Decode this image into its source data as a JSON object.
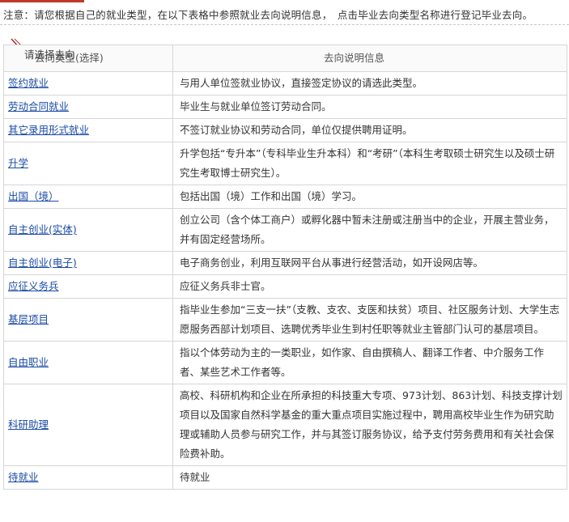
{
  "notice": "注意：请您根据自己的就业类型，在以下表格中参照就业去向说明信息，　点击毕业去向类型名称进行登记毕业去向。",
  "overlap_label": "请选择去向",
  "table": {
    "headers": {
      "type": "去向类型(选择)",
      "description": "去向说明信息"
    },
    "rows": [
      {
        "type": "签约就业",
        "description": "与用人单位签就业协议，直接签定协议的请选此类型。"
      },
      {
        "type": "劳动合同就业",
        "description": "毕业生与就业单位签订劳动合同。"
      },
      {
        "type": "其它录用形式就业",
        "description": "不签订就业协议和劳动合同，单位仅提供聘用证明。"
      },
      {
        "type": "升学",
        "description": "升学包括“专升本”（专科毕业生升本科）和“考研”（本科生考取硕士研究生以及硕士研究生考取博士研究生）。"
      },
      {
        "type": "出国（境）",
        "description": "包括出国（境）工作和出国（境）学习。"
      },
      {
        "type": "自主创业(实体)",
        "description": "创立公司（含个体工商户）或孵化器中暂未注册或注册当中的企业，开展主营业务，并有固定经营场所。"
      },
      {
        "type": "自主创业(电子)",
        "description": "电子商务创业，利用互联网平台从事进行经营活动，如开设网店等。"
      },
      {
        "type": "应征义务兵",
        "description": "应征义务兵非士官。"
      },
      {
        "type": "基层项目",
        "description": "指毕业生参加“三支一扶”（支教、支农、支医和扶贫）项目、社区服务计划、大学生志愿服务西部计划项目、选聘优秀毕业生到村任职等就业主管部门认可的基层项目。"
      },
      {
        "type": "自由职业",
        "description": "指以个体劳动为主的一类职业，如作家、自由撰稿人、翻译工作者、中介服务工作者、某些艺术工作者等。"
      },
      {
        "type": "科研助理",
        "description": "高校、科研机构和企业在所承担的科技重大专项、973计划、863计划、科技支撑计划项目以及国家自然科学基金的重大重点项目实施过程中，聘用高校毕业生作为研究助理或辅助人员参与研究工作，并与其签订服务协议，给予支付劳务费用和有关社会保险费补助。"
      },
      {
        "type": "待就业",
        "description": "待就业"
      }
    ]
  }
}
